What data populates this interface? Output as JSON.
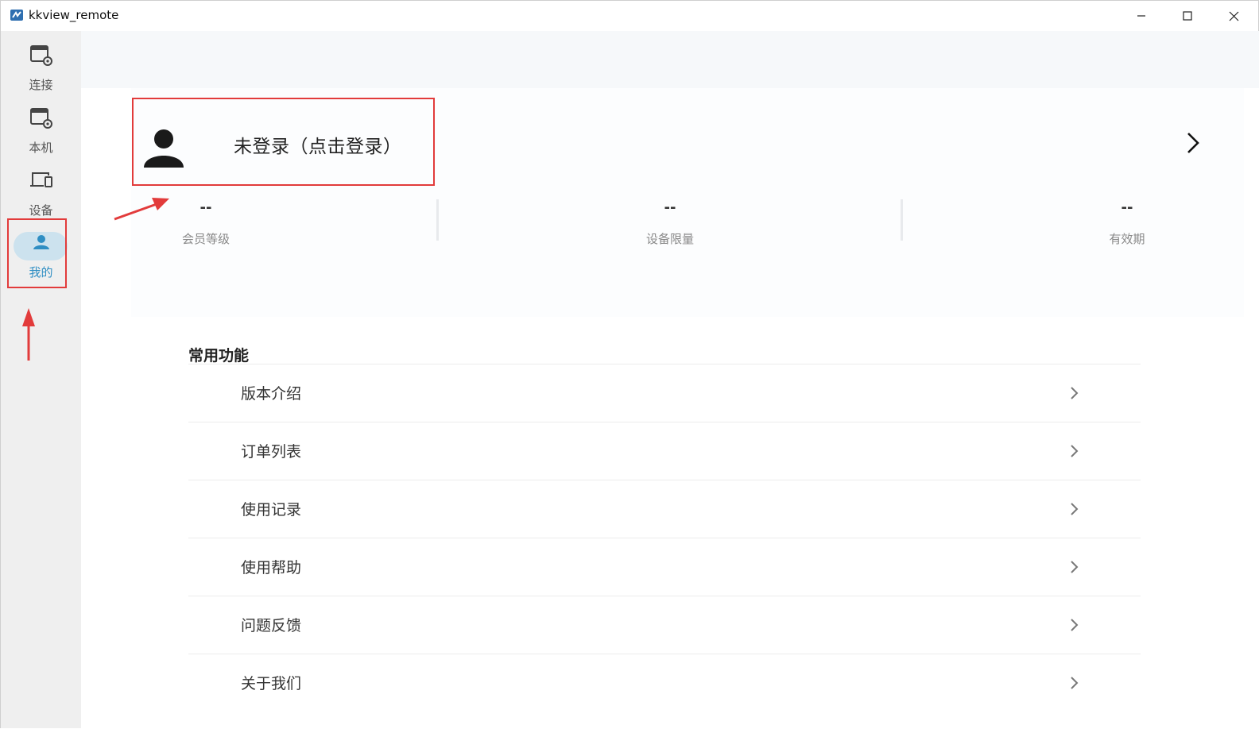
{
  "window": {
    "title": "kkview_remote"
  },
  "sidebar": {
    "items": [
      {
        "label": "连接",
        "icon": "connect-window-gear-icon"
      },
      {
        "label": "本机",
        "icon": "local-window-gear-icon"
      },
      {
        "label": "设备",
        "icon": "devices-icon"
      },
      {
        "label": "我的",
        "icon": "user-icon",
        "active": true
      }
    ]
  },
  "profile": {
    "login_text": "未登录（点击登录）",
    "stats": [
      {
        "value": "--",
        "label": "会员等级"
      },
      {
        "value": "--",
        "label": "设备限量"
      },
      {
        "value": "--",
        "label": "有效期"
      }
    ]
  },
  "functions": {
    "title": "常用功能",
    "items": [
      {
        "label": "版本介绍"
      },
      {
        "label": "订单列表"
      },
      {
        "label": "使用记录"
      },
      {
        "label": "使用帮助"
      },
      {
        "label": "问题反馈"
      },
      {
        "label": "关于我们"
      }
    ]
  },
  "colors": {
    "accent": "#2f8ec3",
    "active_pill": "#cce2ee",
    "annotation": "#e23b3b",
    "sidebar_bg": "#efefef"
  }
}
